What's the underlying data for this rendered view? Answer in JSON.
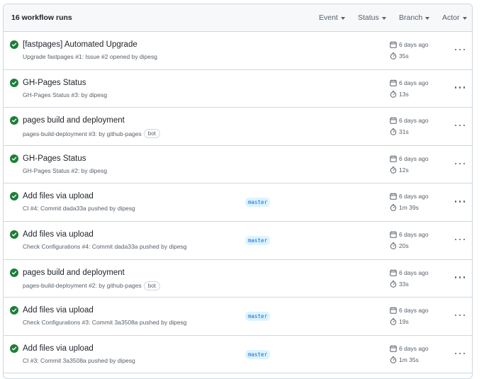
{
  "header": {
    "title": "16 workflow runs",
    "filters": [
      {
        "label": "Event"
      },
      {
        "label": "Status"
      },
      {
        "label": "Branch"
      },
      {
        "label": "Actor"
      }
    ]
  },
  "colors": {
    "success": "#1a7f37",
    "branch_bg": "#ddf4ff",
    "branch_fg": "#0969da"
  },
  "icons": {
    "status": "check-circle-fill-icon",
    "date": "calendar-icon",
    "duration": "stopwatch-icon",
    "menu": "kebab-horizontal-icon"
  },
  "runs": [
    {
      "title": "[fastpages] Automated Upgrade",
      "subtitle": "Upgrade fastpages #1: Issue #2 opened by dipesg",
      "badge": "",
      "branch": "",
      "date": "6 days ago",
      "duration": "35s"
    },
    {
      "title": "GH-Pages Status",
      "subtitle": "GH-Pages Status #3: by dipesg",
      "badge": "",
      "branch": "",
      "date": "6 days ago",
      "duration": "13s"
    },
    {
      "title": "pages build and deployment",
      "subtitle": "pages-build-deployment #3: by github-pages",
      "badge": "bot",
      "branch": "",
      "date": "6 days ago",
      "duration": "31s"
    },
    {
      "title": "GH-Pages Status",
      "subtitle": "GH-Pages Status #2: by dipesg",
      "badge": "",
      "branch": "",
      "date": "6 days ago",
      "duration": "12s"
    },
    {
      "title": "Add files via upload",
      "subtitle": "CI #4: Commit dada33a pushed by dipesg",
      "badge": "",
      "branch": "master",
      "date": "6 days ago",
      "duration": "1m 39s"
    },
    {
      "title": "Add files via upload",
      "subtitle": "Check Configurations #4: Commit dada33a pushed by dipesg",
      "badge": "",
      "branch": "master",
      "date": "6 days ago",
      "duration": "20s"
    },
    {
      "title": "pages build and deployment",
      "subtitle": "pages-build-deployment #2: by github-pages",
      "badge": "bot",
      "branch": "",
      "date": "6 days ago",
      "duration": "33s"
    },
    {
      "title": "Add files via upload",
      "subtitle": "Check Configurations #3: Commit 3a3508a pushed by dipesg",
      "badge": "",
      "branch": "master",
      "date": "6 days ago",
      "duration": "19s"
    },
    {
      "title": "Add files via upload",
      "subtitle": "CI #3: Commit 3a3508a pushed by dipesg",
      "badge": "",
      "branch": "master",
      "date": "6 days ago",
      "duration": "1m 35s"
    }
  ]
}
